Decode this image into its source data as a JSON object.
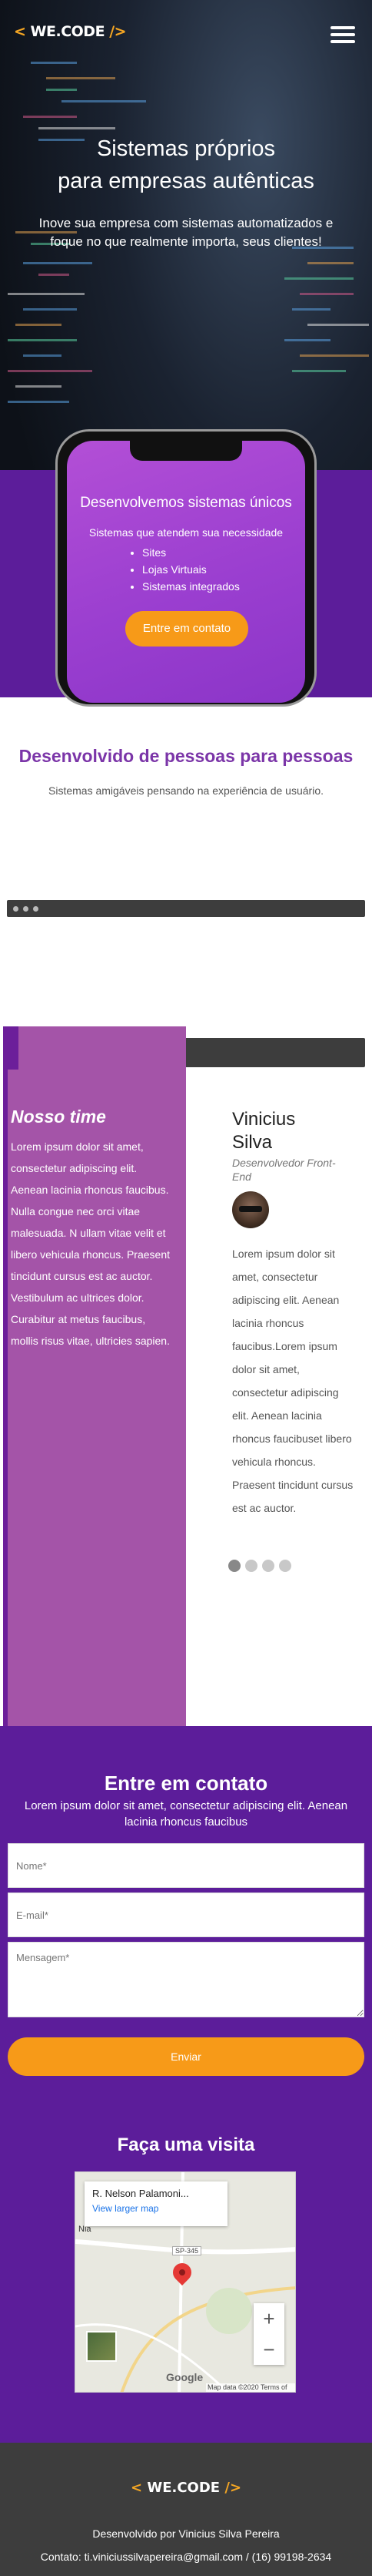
{
  "header": {
    "logo_open": "<",
    "logo_text": "WE.CODE",
    "logo_close": "/>"
  },
  "hero": {
    "title_line1": "Sistemas próprios",
    "title_line2": "para empresas autênticas",
    "subtitle": "Inove sua empresa com sistemas automatizados e foque no que realmente importa, seus clientes!"
  },
  "phone": {
    "title": "Desenvolvemos sistemas únicos",
    "subtitle": "Sistemas que atendem sua necessidade",
    "items": [
      "Sites",
      "Lojas Virtuais",
      "Sistemas integrados"
    ],
    "cta_label": "Entre em contato"
  },
  "section_people": {
    "title": "Desenvolvido de pessoas para pessoas",
    "subtitle": "Sistemas amigáveis pensando na experiência de usuário."
  },
  "team": {
    "title": "Nosso time",
    "text": "Lorem ipsum dolor sit amet, consectetur adipiscing elit. Aenean lacinia rhoncus faucibus. Nulla congue nec orci vitae malesuada. N ullam vitae velit et libero vehicula rhoncus. Praesent tincidunt cursus est ac auctor. Vestibulum ac ultrices dolor. Curabitur at metus faucibus, mollis risus vitae, ultricies sapien.",
    "member": {
      "name_line1": "Vinicius",
      "name_line2": "Silva",
      "role": "Desenvolvedor Front-End",
      "bio": "Lorem ipsum dolor sit amet, consectetur adipiscing elit. Aenean lacinia rhoncus faucibus.Lorem ipsum dolor sit amet, consectetur adipiscing elit. Aenean lacinia rhoncus faucibuset libero vehicula rhoncus. Praesent tincidunt cursus est ac auctor."
    },
    "carousel_pages": 4,
    "carousel_active": 1
  },
  "contact": {
    "title": "Entre em contato",
    "subtitle": "Lorem ipsum dolor sit amet, consectetur adipiscing elit. Aenean lacinia rhoncus faucibus",
    "name_placeholder": "Nome*",
    "email_placeholder": "E-mail*",
    "message_placeholder": "Mensagem*",
    "send_label": "Enviar"
  },
  "visit": {
    "title": "Faça uma visita",
    "map_place_name": "R. Nelson Palamoni...",
    "map_larger_link": "View larger map",
    "map_area_label": "Nia",
    "map_road_label": "SP-345",
    "map_brand": "Google",
    "map_footer": "Map data ©2020   Terms of Use",
    "zoom_in": "+",
    "zoom_out": "−"
  },
  "footer": {
    "logo_open": "<",
    "logo_text": "WE.CODE",
    "logo_close": "/>",
    "developed_by": "Desenvolvido por Vinicius Silva Pereira",
    "contact_line": "Contato: ti.viniciussilvapereira@gmail.com / (16) 99198-2634"
  },
  "colors": {
    "brand_purple": "#5c1d9a",
    "accent_orange": "#f79a18",
    "team_panel": "#a454a8",
    "footer_bg": "#3d3d3d"
  },
  "icons": {
    "menu": "hamburger-icon",
    "map_pin": "map-pin-icon"
  }
}
